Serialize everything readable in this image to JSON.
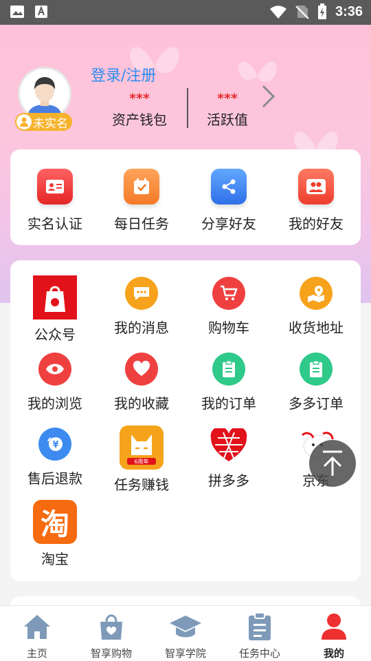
{
  "status_bar": {
    "time": "3:36"
  },
  "profile": {
    "login_label": "登录/注册",
    "badge_label": "未实名",
    "stats": [
      {
        "value": "***",
        "label": "资产钱包"
      },
      {
        "value": "***",
        "label": "活跃值"
      }
    ]
  },
  "quick_actions": [
    {
      "label": "实名认证",
      "icon": "id-card-icon",
      "color": "#f23b3b"
    },
    {
      "label": "每日任务",
      "icon": "calendar-check-icon",
      "color": "#f6883a"
    },
    {
      "label": "分享好友",
      "icon": "share-icon",
      "color": "#3d8bf0"
    },
    {
      "label": "我的好友",
      "icon": "friends-icon",
      "color": "#f0533e"
    }
  ],
  "grid": [
    {
      "label": "公众号",
      "icon": "shopping-bag-logo-icon"
    },
    {
      "label": "我的消息",
      "icon": "message-icon",
      "color": "#f7a21c"
    },
    {
      "label": "购物车",
      "icon": "cart-icon",
      "color": "#ef4040"
    },
    {
      "label": "收货地址",
      "icon": "location-icon",
      "color": "#f7a21c"
    },
    {
      "label": "我的浏览",
      "icon": "eye-icon",
      "color": "#ef4040"
    },
    {
      "label": "我的收藏",
      "icon": "heart-icon",
      "color": "#ef4040"
    },
    {
      "label": "我的订单",
      "icon": "clipboard-icon",
      "color": "#2fc98a"
    },
    {
      "label": "多多订单",
      "icon": "clipboard-icon",
      "color": "#2fc98a"
    },
    {
      "label": "售后退款",
      "icon": "refund-icon",
      "color": "#3d8bf0"
    },
    {
      "label": "任务赚钱",
      "icon": "cat-app-icon",
      "badge_text": "6周年"
    },
    {
      "label": "拼多多",
      "icon": "pinduoduo-icon"
    },
    {
      "label": "京东",
      "icon": "jd-dog-icon"
    },
    {
      "label": "淘宝",
      "icon": "taobao-icon",
      "logo_text": "淘"
    }
  ],
  "tabs": [
    {
      "label": "主页",
      "icon": "home-icon"
    },
    {
      "label": "智享购物",
      "icon": "shopping-bag-icon"
    },
    {
      "label": "智享学院",
      "icon": "graduation-cap-icon"
    },
    {
      "label": "任务中心",
      "icon": "clipboard-icon"
    },
    {
      "label": "我的",
      "icon": "user-icon",
      "active": true
    }
  ]
}
